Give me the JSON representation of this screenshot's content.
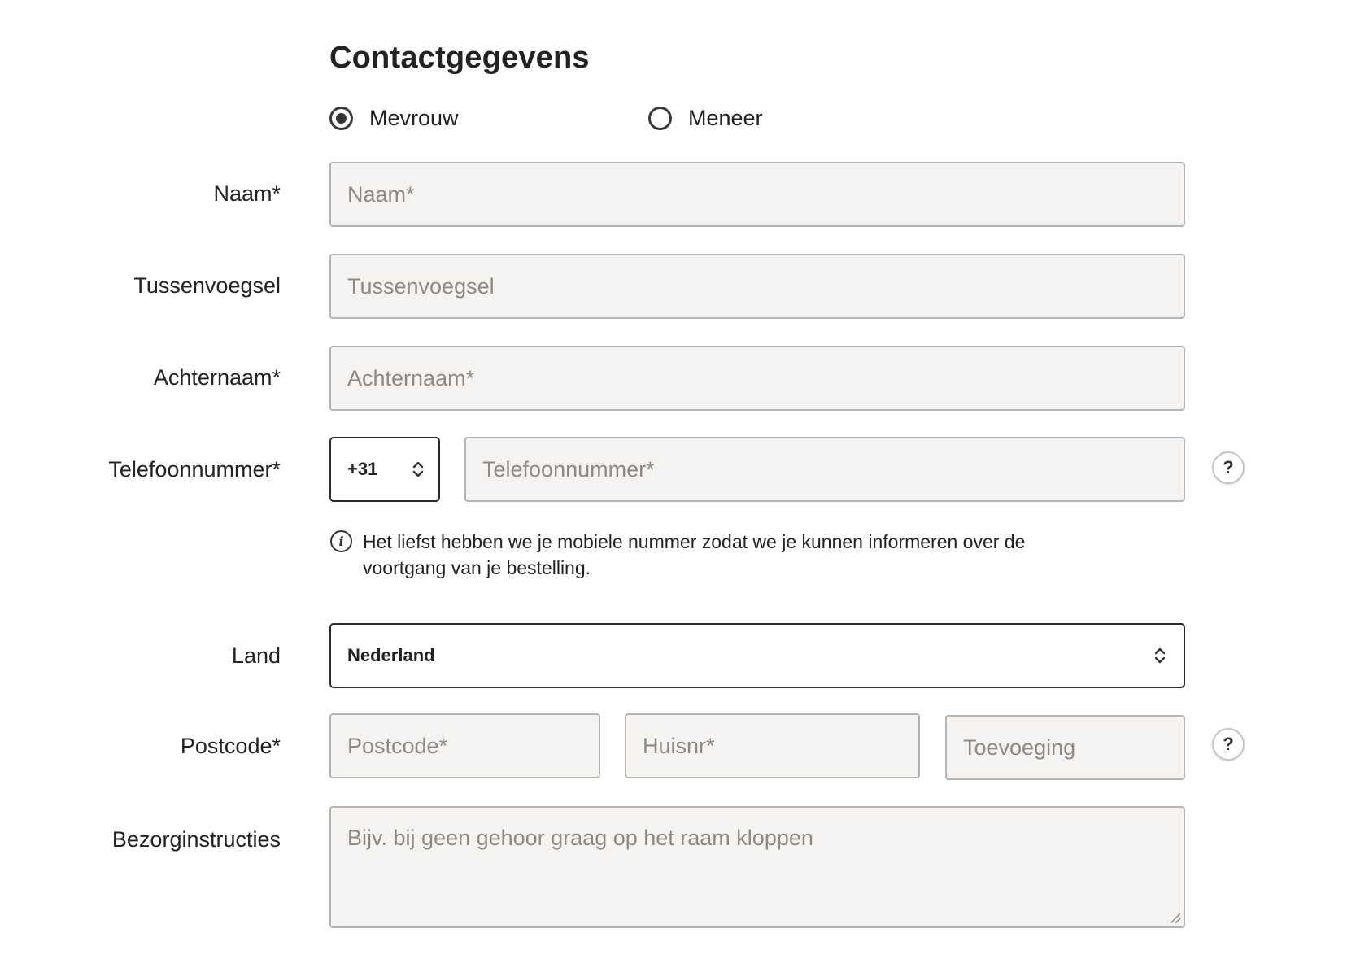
{
  "section": {
    "title": "Contactgegevens"
  },
  "salutation": {
    "options": [
      {
        "label": "Mevrouw",
        "selected": true
      },
      {
        "label": "Meneer",
        "selected": false
      }
    ]
  },
  "fields": {
    "naam": {
      "label": "Naam*",
      "placeholder": "Naam*"
    },
    "tussenvoegsel": {
      "label": "Tussenvoegsel",
      "placeholder": "Tussenvoegsel"
    },
    "achternaam": {
      "label": "Achternaam*",
      "placeholder": "Achternaam*"
    },
    "telefoon": {
      "label": "Telefoonnummer*",
      "country_code": "+31",
      "placeholder": "Telefoonnummer*",
      "help": "?",
      "info": "Het liefst hebben we je mobiele nummer zodat we je kunnen informeren over de voortgang van je bestelling."
    },
    "land": {
      "label": "Land",
      "value": "Nederland"
    },
    "postcode": {
      "label": "Postcode*",
      "postcode_placeholder": "Postcode*",
      "huisnr_placeholder": "Huisnr*",
      "toevoeging_placeholder": "Toevoeging",
      "help": "?"
    },
    "bezorginstructies": {
      "label": "Bezorginstructies",
      "placeholder": "Bijv. bij geen gehoor graag op het raam kloppen"
    }
  },
  "icons": {
    "info": "info-icon",
    "help": "question-mark-icon",
    "chevron": "chevron-up-down-icon",
    "radio": "radio-icon"
  },
  "colors": {
    "field_bg": "#f4f3f1",
    "field_border": "#b7b4b0",
    "placeholder": "#8d8a86",
    "text": "#222222",
    "select_border": "#2a2a2a"
  }
}
